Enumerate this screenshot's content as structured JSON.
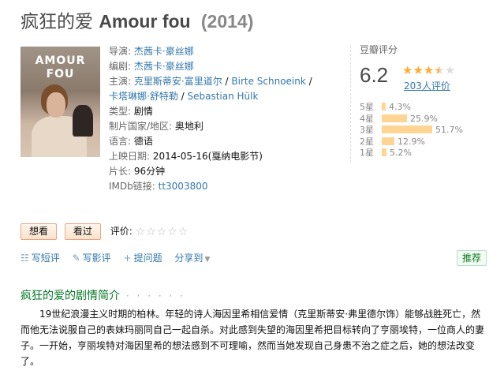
{
  "title": {
    "cn": "疯狂的爱",
    "latin": "Amour fou",
    "year": "(2014)"
  },
  "poster": {
    "line1": "AMOUR",
    "line2": "FOU"
  },
  "info": {
    "director_label": "导演:",
    "director": "杰茜卡·豪丝娜",
    "writer_label": "编剧:",
    "writer": "杰茜卡·豪丝娜",
    "cast_label": "主演:",
    "cast": [
      "克里斯蒂安·富里道尔",
      "Birte Schnoeink",
      "卡塔琳娜·舒特勒",
      "Sebastian Hülk"
    ],
    "cast_sep": " / ",
    "genre_label": "类型:",
    "genre": "剧情",
    "country_label": "制片国家/地区:",
    "country": "奥地利",
    "language_label": "语言:",
    "language": "德语",
    "release_label": "上映日期:",
    "release": "2014-05-16(戛纳电影节)",
    "runtime_label": "片长:",
    "runtime": "96分钟",
    "imdb_label": "IMDb链接:",
    "imdb": "tt3003800"
  },
  "rating": {
    "label": "豆瓣评分",
    "score": "6.2",
    "stars_value": 3.5,
    "votes": "203人评价",
    "distribution": [
      {
        "label": "5星",
        "pct": "4.3%",
        "value": 4.3
      },
      {
        "label": "4星",
        "pct": "25.9%",
        "value": 25.9
      },
      {
        "label": "3星",
        "pct": "51.7%",
        "value": 51.7
      },
      {
        "label": "2星",
        "pct": "12.9%",
        "value": 12.9
      },
      {
        "label": "1星",
        "pct": "5.2%",
        "value": 5.2
      }
    ]
  },
  "buttons": {
    "want": "想看",
    "seen": "看过",
    "rate_label": "评价:"
  },
  "actions": {
    "short_review": "写短评",
    "review": "写影评",
    "question": "提问题",
    "share": "分享到",
    "recommend": "推荐"
  },
  "summary": {
    "title": "疯狂的爱的剧情简介",
    "dots": "· · · · · ·",
    "text": "19世纪浪漫主义时期的柏林。年轻的诗人海因里希相信爱情（克里斯蒂安·弗里德尔饰）能够战胜死亡，然而他无法说服自己的表妹玛丽同自己一起自杀。对此感到失望的海因里希把目标转向了亨丽埃特，一位商人的妻子。一开始，亨丽埃特对海因里希的想法感到不可理喻，然而当她发现自己身患不治之症之后，她的想法改变了。"
  },
  "colors": {
    "link": "#3377aa",
    "green": "#007722",
    "star": "#ffac2d",
    "bar": "#ffd596"
  }
}
